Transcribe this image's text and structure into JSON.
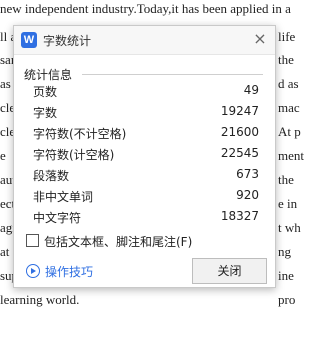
{
  "document": {
    "lines": [
      "new independent industry.Today,it has been applied in a",
      "ll a",
      "sam",
      "as h",
      "clea",
      "clea",
      "e",
      "aut",
      "ectr",
      "agil",
      "at",
      "sup",
      "learning world."
    ],
    "right_fragments": [
      "life",
      "the",
      "d as",
      "mac",
      "At p",
      "ment",
      "the",
      "e in",
      "t wh",
      "ng",
      "ine",
      "pro"
    ]
  },
  "dialog": {
    "title": "字数统计",
    "logo_letter": "W",
    "close_icon": "×",
    "section_title": "统计信息",
    "stats": [
      {
        "label": "页数",
        "value": "49"
      },
      {
        "label": "字数",
        "value": "19247"
      },
      {
        "label": "字符数(不计空格)",
        "value": "21600"
      },
      {
        "label": "字符数(计空格)",
        "value": "22545"
      },
      {
        "label": "段落数",
        "value": "673"
      },
      {
        "label": "非中文单词",
        "value": "920"
      },
      {
        "label": "中文字符",
        "value": "18327"
      }
    ],
    "checkbox_label": "包括文本框、脚注和尾注(F)",
    "checkbox_checked": false,
    "tips_label": "操作技巧",
    "close_button": "关闭"
  }
}
